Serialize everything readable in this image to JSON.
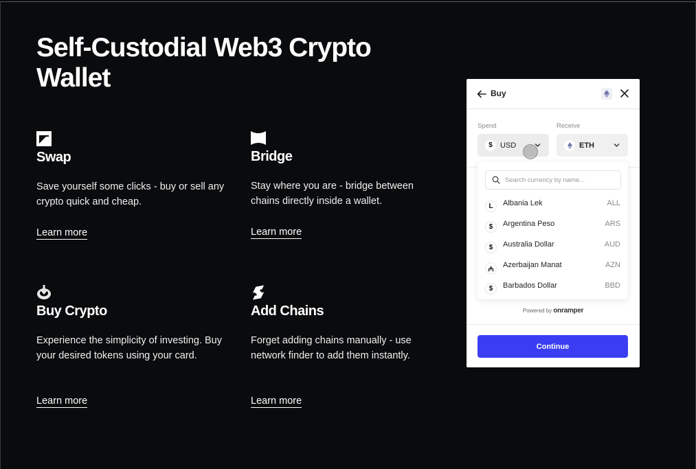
{
  "page": {
    "title": "Self-Custodial Web3 Crypto Wallet"
  },
  "features": [
    {
      "id": "swap",
      "icon": "swap-icon",
      "heading": "Swap",
      "description": "Save yourself some clicks - buy or sell any crypto quick and cheap.",
      "link": "Learn more"
    },
    {
      "id": "bridge",
      "icon": "bridge-icon",
      "heading": "Bridge",
      "description": "Stay where you are - bridge between chains directly inside a wallet.",
      "link": "Learn more"
    },
    {
      "id": "buy-crypto",
      "icon": "download-icon",
      "heading": "Buy Crypto",
      "description": "Experience the simplicity of investing. Buy your desired tokens using your card.",
      "link": "Learn more"
    },
    {
      "id": "add-chains",
      "icon": "chain-link-icon",
      "heading": "Add Chains",
      "description": "Forget adding chains manually - use network finder to add them instantly.",
      "link": "Learn more"
    }
  ],
  "widget": {
    "title": "Buy",
    "spend_label": "Spend",
    "receive_label": "Receive",
    "spend_currency": {
      "symbol": "$",
      "code": "USD"
    },
    "receive_currency": {
      "symbol": "eth-icon",
      "code": "ETH"
    },
    "search_placeholder": "Search currency by name...",
    "currencies": [
      {
        "symbol": "L",
        "name": "Albania Lek",
        "code": "ALL"
      },
      {
        "symbol": "$",
        "name": "Argentina Peso",
        "code": "ARS"
      },
      {
        "symbol": "$",
        "name": "Australia Dollar",
        "code": "AUD"
      },
      {
        "symbol": "₼",
        "name": "Azerbaijan Manat",
        "code": "AZN"
      },
      {
        "symbol": "$",
        "name": "Barbados Dollar",
        "code": "BBD"
      }
    ],
    "powered_by": "Powered by",
    "provider": "onramper",
    "continue_label": "Continue",
    "accent_color": "#3a3df2"
  }
}
